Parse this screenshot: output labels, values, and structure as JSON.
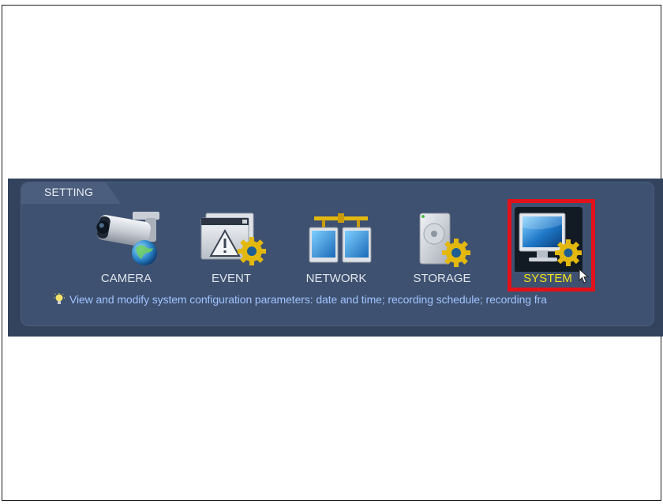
{
  "panel": {
    "title": "SETTING"
  },
  "menu": [
    {
      "label": "CAMERA",
      "icon": "camera-globe-icon"
    },
    {
      "label": "EVENT",
      "icon": "event-warning-gear-icon"
    },
    {
      "label": "NETWORK",
      "icon": "network-monitors-icon"
    },
    {
      "label": "STORAGE",
      "icon": "hard-disk-gear-icon"
    },
    {
      "label": "SYSTEM",
      "icon": "monitor-gear-icon",
      "selected": true
    }
  ],
  "hint": {
    "icon": "lightbulb-icon",
    "text": "View and modify system configuration parameters: date and time; recording schedule; recording fra"
  },
  "colors": {
    "panel_bg": "#3f5170",
    "label": "#dfe4ec",
    "selected_label": "#f2e218",
    "highlight_border": "#e3121a",
    "hint_text": "#9fc3ff"
  }
}
